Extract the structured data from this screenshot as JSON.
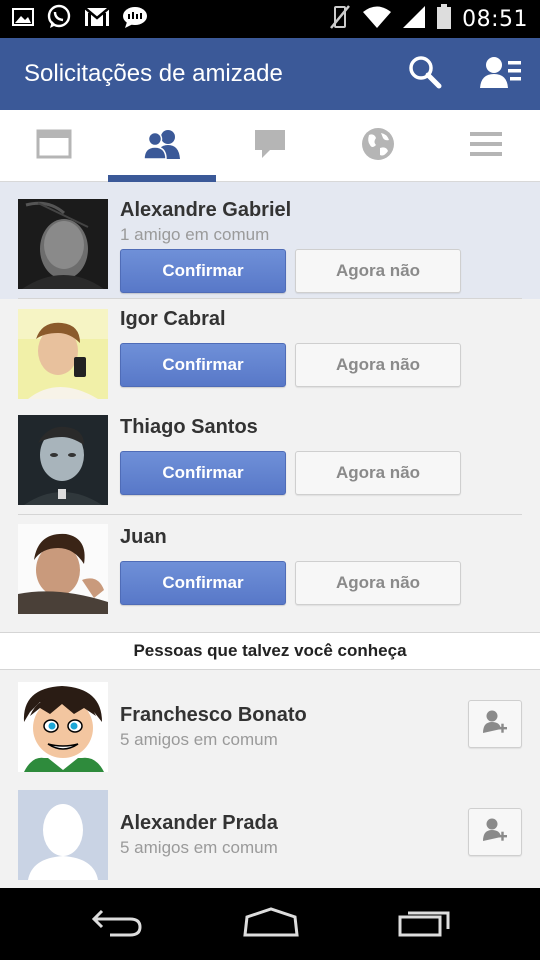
{
  "status_bar": {
    "time": "08:51",
    "left_icons": [
      "image-icon",
      "whatsapp-icon",
      "gmail-icon",
      "chat-bubble-icon"
    ],
    "right_icons": [
      "vibrate-off-icon",
      "wifi-icon",
      "signal-icon",
      "battery-icon"
    ]
  },
  "app_bar": {
    "title": "Solicitações de amizade",
    "actions": [
      "search-icon",
      "friend-list-icon"
    ],
    "color": "#3b5998"
  },
  "tabs": [
    {
      "icon": "news-feed-icon",
      "active": false
    },
    {
      "icon": "friend-requests-icon",
      "active": true
    },
    {
      "icon": "messages-icon",
      "active": false
    },
    {
      "icon": "notifications-globe-icon",
      "active": false
    },
    {
      "icon": "menu-icon",
      "active": false
    }
  ],
  "requests": [
    {
      "name": "Alexandre Gabriel",
      "mutual": "1 amigo em comum",
      "confirm_label": "Confirmar",
      "later_label": "Agora não"
    },
    {
      "name": "Igor Cabral",
      "mutual": "",
      "confirm_label": "Confirmar",
      "later_label": "Agora não"
    },
    {
      "name": "Thiago Santos",
      "mutual": "",
      "confirm_label": "Confirmar",
      "later_label": "Agora não"
    },
    {
      "name": "Juan",
      "mutual": "",
      "confirm_label": "Confirmar",
      "later_label": "Agora não"
    }
  ],
  "pymk": {
    "header": "Pessoas que talvez você conheça",
    "people": [
      {
        "name": "Franchesco Bonato",
        "mutual": "5 amigos em comum"
      },
      {
        "name": "Alexander Prada",
        "mutual": "5 amigos em comum"
      }
    ]
  },
  "nav_bar": {
    "icons": [
      "back-icon",
      "home-icon",
      "recent-apps-icon"
    ]
  }
}
